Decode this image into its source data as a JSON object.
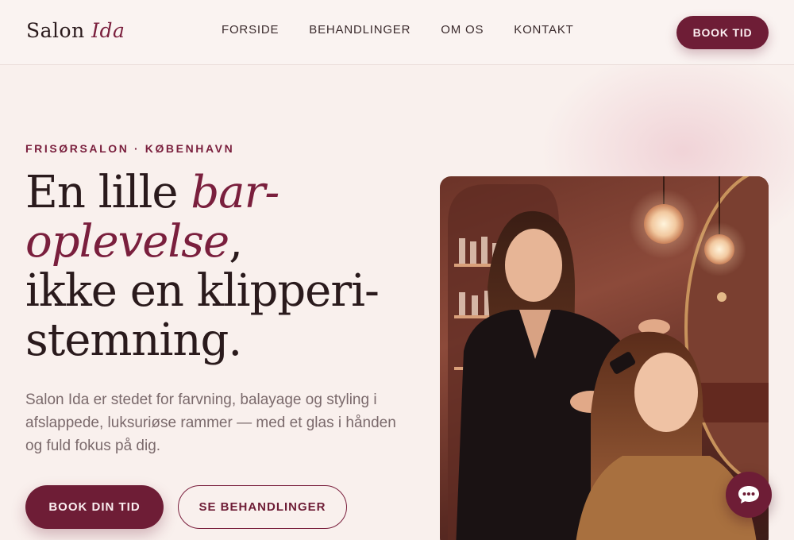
{
  "header": {
    "logo_main": "Salon",
    "logo_accent": "Ida",
    "nav": [
      "FORSIDE",
      "BEHANDLINGER",
      "OM OS",
      "KONTAKT"
    ],
    "cta": "BOOK TID"
  },
  "hero": {
    "eyebrow": "FRISØRSALON · KØBENHAVN",
    "title_line1_a": "En lille ",
    "title_line1_em": "bar-",
    "title_line2_em": "oplevelse",
    "title_line2_b": ",",
    "title_line3": "ikke en klipperi-",
    "title_line4": "stemning.",
    "lead": "Salon Ida er stedet for farvning, balayage og styling i afslappede, luksuriøse rammer — med et glas i hånden og fuld fokus på dig.",
    "primary_button": "BOOK DIN TID",
    "secondary_button": "SE BEHANDLINGER"
  },
  "colors": {
    "accent": "#7a1f3d",
    "button": "#6e1d36",
    "background": "#f9f0ed"
  },
  "icons": {
    "chat": "chat-bubble-icon"
  }
}
